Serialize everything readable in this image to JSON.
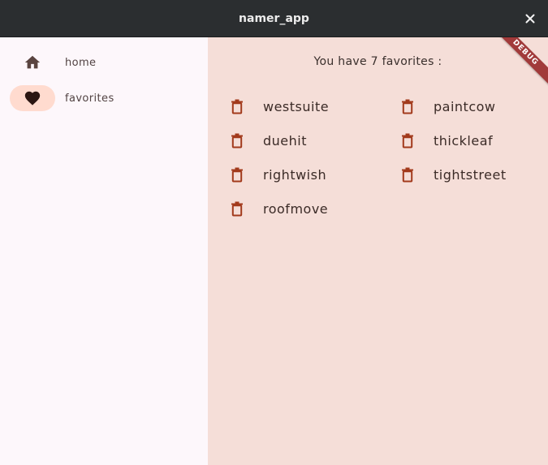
{
  "window": {
    "title": "namer_app",
    "close_icon": "close-icon",
    "close_glyph": "✕"
  },
  "sidebar": {
    "items": [
      {
        "label": "home",
        "icon": "home-icon",
        "active": false
      },
      {
        "label": "favorites",
        "icon": "heart-icon",
        "active": true
      }
    ]
  },
  "main": {
    "header": "You have 7 favorites :",
    "favorites": [
      {
        "name": "westsuite"
      },
      {
        "name": "paintcow"
      },
      {
        "name": "duehit"
      },
      {
        "name": "thickleaf"
      },
      {
        "name": "rightwish"
      },
      {
        "name": "tightstreet"
      },
      {
        "name": "roofmove"
      }
    ],
    "delete_icon": "trash-icon"
  },
  "debug_banner": "DEBUG",
  "colors": {
    "titlebar": "#2b2e30",
    "sidebar_bg": "#fdf7fb",
    "content_bg": "#f5ded8",
    "active_pill": "#ffdbcf",
    "trash_icon": "#a23a1c",
    "nav_icon": "#5a4440",
    "debug_ribbon": "#a13a3a"
  }
}
